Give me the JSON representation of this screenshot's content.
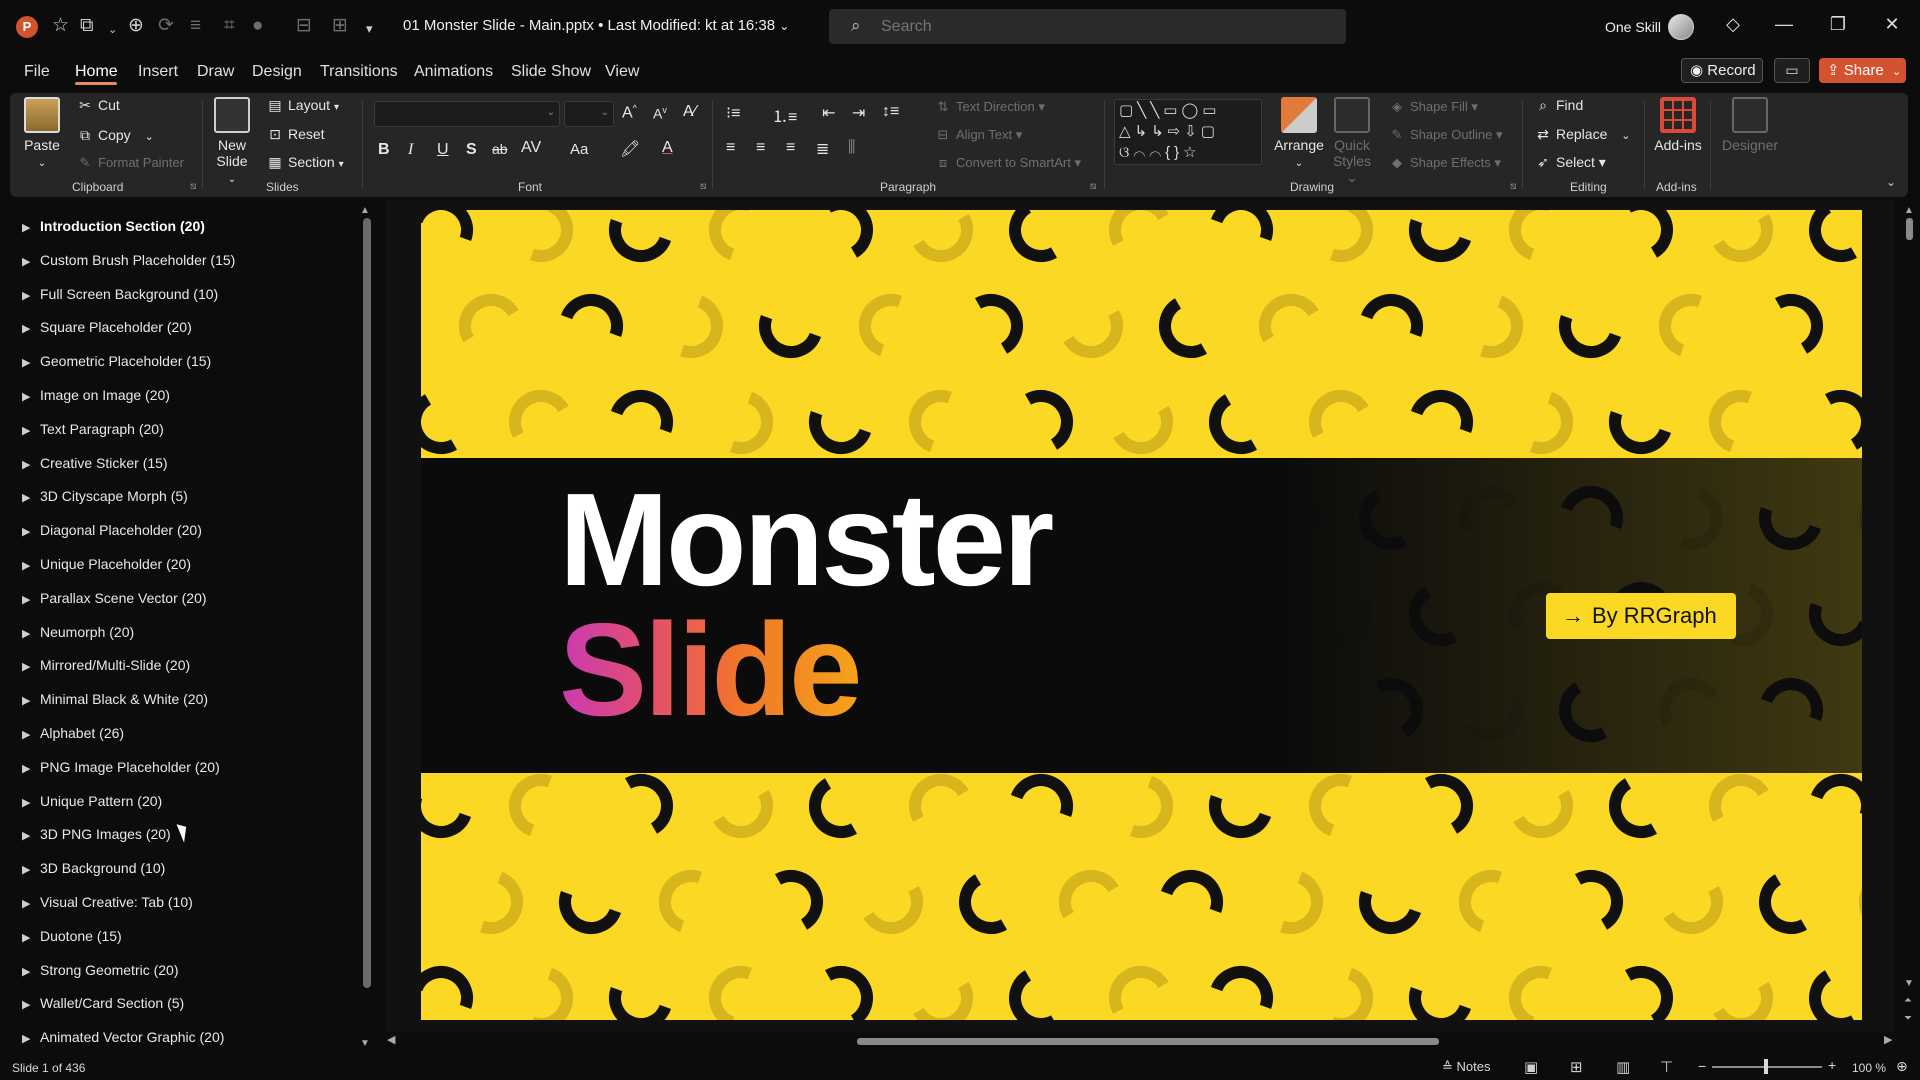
{
  "app": {
    "logo_letter": "P",
    "accent": "#d35230"
  },
  "titlebar": {
    "doc_title": "01 Monster Slide - Main.pptx • Last Modified: kt at 16:38",
    "search_placeholder": "Search",
    "user_name": "One Skill",
    "qat_icons": [
      "autosave-icon",
      "save-icon",
      "undo-icon",
      "redo-icon",
      "crop-icon",
      "shape-icon",
      "align-icon",
      "customize-icon"
    ]
  },
  "menu": {
    "tabs": [
      "File",
      "Home",
      "Insert",
      "Draw",
      "Design",
      "Transitions",
      "Animations",
      "Slide Show",
      "View"
    ],
    "active": "Home",
    "record": "Record",
    "share": "Share"
  },
  "ribbon": {
    "clipboard": {
      "paste": "Paste",
      "cut": "Cut",
      "copy": "Copy",
      "format_painter": "Format Painter",
      "label": "Clipboard"
    },
    "slides": {
      "new_slide_1": "New",
      "new_slide_2": "Slide",
      "layout": "Layout",
      "reset": "Reset",
      "section": "Section",
      "label": "Slides"
    },
    "font": {
      "label": "Font",
      "bold": "B",
      "italic": "I",
      "underline": "U",
      "shadow": "S",
      "strike": "ab",
      "spacing": "AV",
      "case": "Aa"
    },
    "paragraph": {
      "label": "Paragraph",
      "text_direction": "Text Direction",
      "align_text": "Align Text",
      "smartart": "Convert to SmartArt"
    },
    "drawing": {
      "label": "Drawing",
      "arrange": "Arrange",
      "quick_styles_1": "Quick",
      "quick_styles_2": "Styles",
      "shape_fill": "Shape Fill",
      "shape_outline": "Shape Outline",
      "shape_effects": "Shape Effects"
    },
    "editing": {
      "label": "Editing",
      "find": "Find",
      "replace": "Replace",
      "select": "Select"
    },
    "addins": {
      "label": "Add-ins",
      "addins_btn": "Add-ins",
      "designer": "Designer"
    }
  },
  "sections": [
    "Introduction Section (20)",
    "Custom Brush Placeholder (15)",
    "Full Screen Background (10)",
    "Square Placeholder (20)",
    "Geometric Placeholder (15)",
    "Image on Image (20)",
    "Text Paragraph (20)",
    "Creative Sticker (15)",
    "3D Cityscape Morph (5)",
    "Diagonal Placeholder (20)",
    "Unique Placeholder (20)",
    "Parallax Scene Vector (20)",
    "Neumorph (20)",
    "Mirrored/Multi-Slide (20)",
    "Minimal Black & White (20)",
    "Alphabet (26)",
    "PNG Image Placeholder (20)",
    "Unique Pattern (20)",
    "3D PNG Images (20)",
    "3D Background (10)",
    "Visual Creative: Tab (10)",
    "Duotone (15)",
    "Strong Geometric (20)",
    "Wallet/Card Section (5)",
    "Animated Vector Graphic (20)"
  ],
  "slide": {
    "title_line1": "Monster",
    "title_line2": "Slide",
    "byline": "By RRGraph",
    "background_color": "#fbd824",
    "band_color": "#0b0b0b"
  },
  "status": {
    "slide_info": "Slide 1 of 436",
    "notes": "Notes",
    "zoom": "100 %"
  }
}
